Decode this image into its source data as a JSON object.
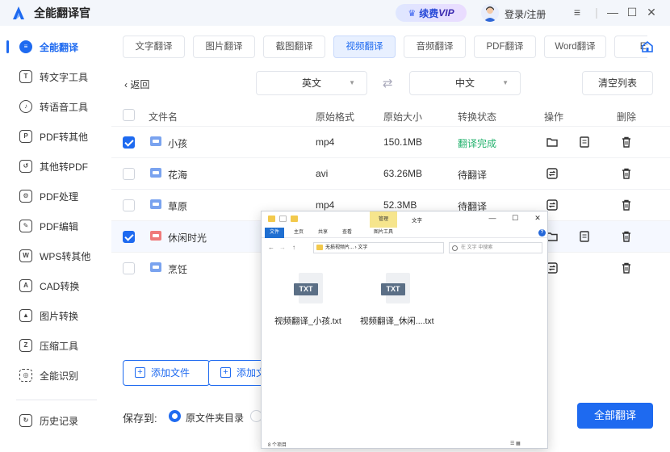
{
  "app": {
    "title": "全能翻译官",
    "vip_label_prefix": "续费",
    "vip_label_suffix": "VIP",
    "login": "登录/注册"
  },
  "colors": {
    "accent": "#1e6af0",
    "done": "#23b26d"
  },
  "sidebar": {
    "items": [
      {
        "label": "全能翻译",
        "icon": "translate-icon"
      },
      {
        "label": "转文字工具",
        "icon": "text-tool-icon"
      },
      {
        "label": "转语音工具",
        "icon": "voice-tool-icon"
      },
      {
        "label": "PDF转其他",
        "icon": "pdf-convert-icon"
      },
      {
        "label": "其他转PDF",
        "icon": "to-pdf-icon"
      },
      {
        "label": "PDF处理",
        "icon": "pdf-process-icon"
      },
      {
        "label": "PDF编辑",
        "icon": "pdf-edit-icon"
      },
      {
        "label": "WPS转其他",
        "icon": "wps-icon"
      },
      {
        "label": "CAD转换",
        "icon": "cad-icon"
      },
      {
        "label": "图片转换",
        "icon": "image-icon"
      },
      {
        "label": "压缩工具",
        "icon": "compress-icon"
      },
      {
        "label": "全能识别",
        "icon": "recognize-icon"
      },
      {
        "label": "历史记录",
        "icon": "history-icon"
      }
    ]
  },
  "tabs": [
    {
      "label": "文字翻译"
    },
    {
      "label": "图片翻译"
    },
    {
      "label": "截图翻译"
    },
    {
      "label": "视频翻译"
    },
    {
      "label": "音频翻译"
    },
    {
      "label": "PDF翻译"
    },
    {
      "label": "Word翻译"
    },
    {
      "label": "Ex"
    }
  ],
  "toolbar": {
    "back": "返回",
    "source_lang": "英文",
    "target_lang": "中文",
    "clear": "清空列表"
  },
  "table": {
    "headers": {
      "name": "文件名",
      "format": "原始格式",
      "size": "原始大小",
      "status": "转换状态",
      "ops": "操作",
      "delete": "删除"
    },
    "rows": [
      {
        "name": "小孩",
        "format": "mp4",
        "size": "150.1MB",
        "status": "翻译完成",
        "checked": true
      },
      {
        "name": "花海",
        "format": "avi",
        "size": "63.26MB",
        "status": "待翻译",
        "checked": false
      },
      {
        "name": "草原",
        "format": "mp4",
        "size": "52.3MB",
        "status": "待翻译",
        "checked": false
      },
      {
        "name": "休闲时光",
        "format": "",
        "size": "",
        "status": "",
        "checked": true
      },
      {
        "name": "烹饪",
        "format": "",
        "size": "",
        "status": "",
        "checked": false
      }
    ]
  },
  "footer": {
    "add_file": "添加文件",
    "add_folder": "添加文",
    "save_to": "保存到:",
    "option_original": "原文件夹目录",
    "translate_all": "全部翻译"
  },
  "explorer": {
    "manage_tab": "管理",
    "title": "文字",
    "ribbon": [
      "文件",
      "主页",
      "共享",
      "查看",
      "图片工具"
    ],
    "path": "无损视频片...  ›  文字",
    "search_placeholder": "在 文字 中搜索",
    "files": [
      {
        "badge": "TXT",
        "name": "视频翻译_小孩.txt"
      },
      {
        "badge": "TXT",
        "name": "视频翻译_休闲....txt"
      }
    ],
    "status": "8 个项目"
  }
}
